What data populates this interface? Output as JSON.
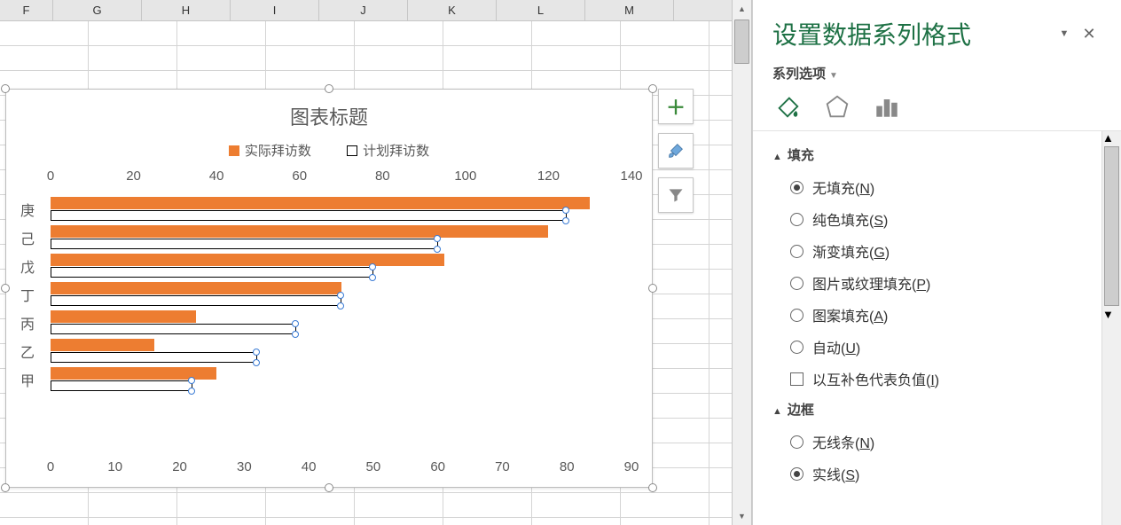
{
  "columns": [
    "F",
    "G",
    "H",
    "I",
    "J",
    "K",
    "L",
    "M"
  ],
  "chart": {
    "title": "图表标题",
    "legend": {
      "series1": "实际拜访数",
      "series2": "计划拜访数"
    },
    "axis_top_max": 140,
    "axis_bottom_max": 90
  },
  "chart_data": {
    "type": "bar",
    "orientation": "horizontal",
    "title": "图表标题",
    "categories": [
      "庚",
      "己",
      "戊",
      "丁",
      "丙",
      "乙",
      "甲"
    ],
    "series": [
      {
        "name": "实际拜访数",
        "axis": "top",
        "values": [
          130,
          120,
          95,
          70,
          35,
          25,
          40
        ],
        "color": "#ed7d31"
      },
      {
        "name": "计划拜访数",
        "axis": "bottom",
        "values": [
          80,
          60,
          50,
          45,
          38,
          32,
          22
        ],
        "color": "#ffffff",
        "border": "#000000",
        "selected": true
      }
    ],
    "x_top": {
      "min": 0,
      "max": 140,
      "step": 20,
      "label": ""
    },
    "x_bottom": {
      "min": 0,
      "max": 90,
      "step": 10,
      "label": ""
    }
  },
  "chart_side_buttons": {
    "add_element": "＋",
    "styles": "brush",
    "filter": "filter"
  },
  "pane": {
    "title": "设置数据系列格式",
    "subtitle": "系列选项",
    "sections": {
      "fill": {
        "label": "填充",
        "options": {
          "none": {
            "text": "无填充",
            "accel": "N",
            "checked": true
          },
          "solid": {
            "text": "纯色填充",
            "accel": "S",
            "checked": false
          },
          "gradient": {
            "text": "渐变填充",
            "accel": "G",
            "checked": false
          },
          "picture": {
            "text": "图片或纹理填充",
            "accel": "P",
            "checked": false
          },
          "pattern": {
            "text": "图案填充",
            "accel": "A",
            "checked": false
          },
          "auto": {
            "text": "自动",
            "accel": "U",
            "checked": false
          }
        },
        "invert_negative": {
          "text": "以互补色代表负值",
          "accel": "I",
          "checked": false
        }
      },
      "border": {
        "label": "边框",
        "options": {
          "none": {
            "text": "无线条",
            "accel": "N",
            "checked": false
          },
          "solid": {
            "text": "实线",
            "accel": "S",
            "checked": true
          }
        }
      }
    }
  }
}
